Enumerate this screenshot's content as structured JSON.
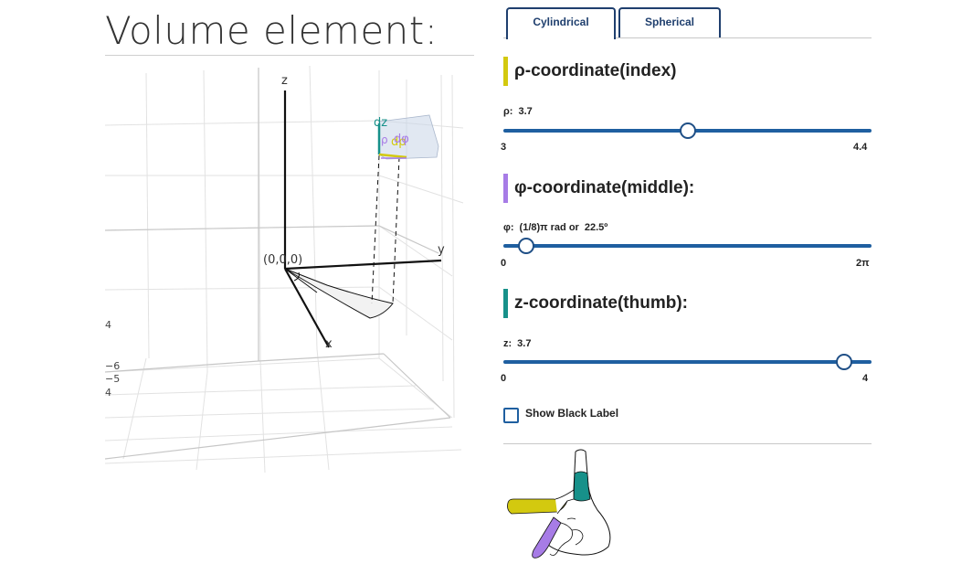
{
  "title": "Volume element:",
  "tabs": [
    {
      "label": "Cylindrical",
      "active": true
    },
    {
      "label": "Spherical",
      "active": false
    }
  ],
  "plot": {
    "axis_labels": {
      "x": "x",
      "y": "y",
      "z": "z"
    },
    "origin_label": "(0,0,0)",
    "element_labels": {
      "dz": "dz",
      "drho": "dρ",
      "dphi": "dφ",
      "rho": "ρ"
    },
    "side_ticks": [
      "4",
      "−6",
      "−5",
      "4"
    ]
  },
  "sections": [
    {
      "heading": "ρ-coordinate(index)",
      "color": "#d3c90f",
      "value_prefix": "ρ:",
      "value_text": "3.7",
      "min_label": "3",
      "max_label": "4.4",
      "min": 3,
      "max": 4.4,
      "value": 3.7
    },
    {
      "heading": "φ-coordinate(middle):",
      "color": "#a77ce6",
      "value_prefix": "φ:",
      "value_text": "(1/8)π rad or",
      "value_extra": "22.5º",
      "min_label": "0",
      "max_label": "2π",
      "min": 0,
      "max": 6.2832,
      "value": 0.3927
    },
    {
      "heading": "z-coordinate(thumb):",
      "color": "#17918a",
      "value_prefix": "z:",
      "value_text": "3.7",
      "min_label": "0",
      "max_label": "4",
      "min": 0,
      "max": 4,
      "value": 3.7
    }
  ],
  "checkbox": {
    "label": "Show Black Label",
    "checked": false
  },
  "colors": {
    "rho": "#d3c90f",
    "phi": "#a77ce6",
    "z": "#17918a",
    "accent": "#1f5fa0"
  }
}
